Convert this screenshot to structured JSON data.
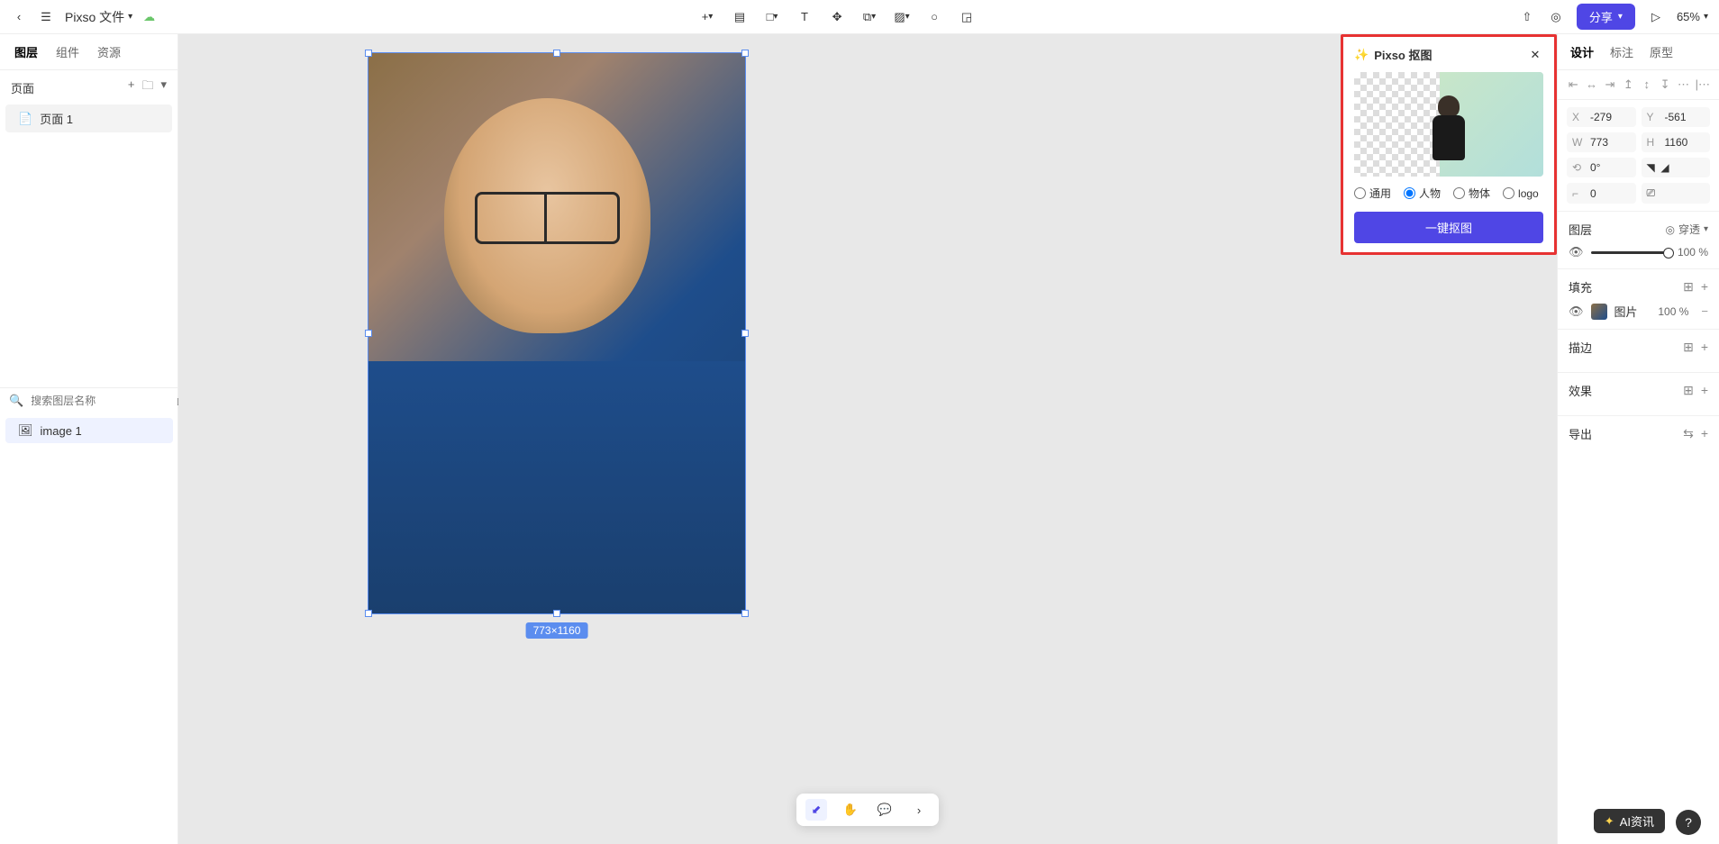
{
  "topbar": {
    "file_title": "Pixso 文件",
    "share_label": "分享",
    "zoom_value": "65%"
  },
  "toolbar_icons": {
    "add": "add-icon",
    "frame": "frame-icon",
    "rect": "rect-icon",
    "text": "text-icon",
    "move": "move-icon",
    "boolean": "boolean-icon",
    "component": "component-icon",
    "ellipse": "ellipse-icon",
    "slice": "slice-icon"
  },
  "left_panel": {
    "tabs": {
      "layers": "图层",
      "components": "组件",
      "assets": "资源"
    },
    "pages_label": "页面",
    "pages": [
      {
        "name": "页面 1"
      }
    ],
    "search_placeholder": "搜索图层名称",
    "layers": [
      {
        "name": "image 1"
      }
    ]
  },
  "canvas": {
    "dimensions": "773×1160"
  },
  "matting_panel": {
    "title": "Pixso 抠图",
    "radios": {
      "general": "通用",
      "people": "人物",
      "object": "物体",
      "logo": "logo"
    },
    "selected_radio": "people",
    "button": "一键抠图"
  },
  "right_panel": {
    "tabs": {
      "design": "设计",
      "annotate": "标注",
      "prototype": "原型"
    },
    "x_label": "X",
    "x_val": "-279",
    "y_label": "Y",
    "y_val": "-561",
    "w_label": "W",
    "w_val": "773",
    "h_label": "H",
    "h_val": "1160",
    "rot_label": "⟲",
    "rot_val": "0°",
    "corner_label": "⌐",
    "corner_val": "0",
    "layer_section": "图层",
    "passthrough": "穿透",
    "opacity_val": "100",
    "unit": "%",
    "fill_section": "填充",
    "fill_type": "图片",
    "fill_opacity": "100",
    "stroke_section": "描边",
    "effects_section": "效果",
    "export_section": "导出"
  },
  "badge": {
    "text": "AI资讯"
  },
  "help": "?"
}
